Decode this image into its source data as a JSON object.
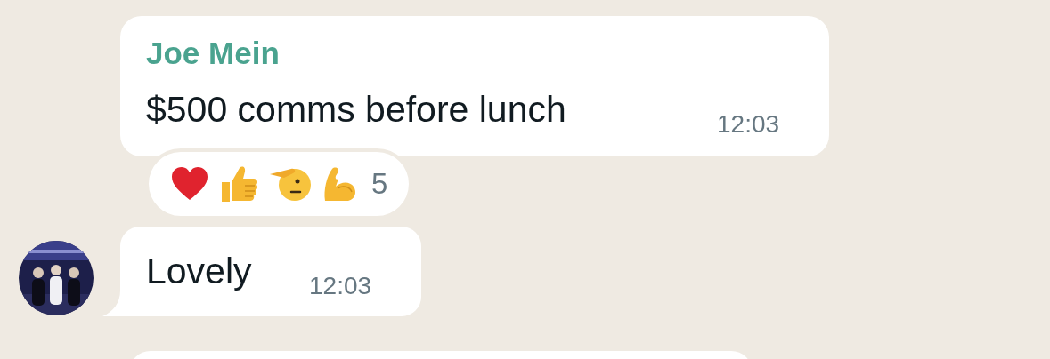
{
  "messages": [
    {
      "kind": "incoming_named",
      "sender": "Joe Mein",
      "text": "$500 comms before lunch",
      "time": "12:03",
      "reactions": [
        {
          "kind": "heart"
        },
        {
          "kind": "thumbs_up"
        },
        {
          "kind": "salute"
        },
        {
          "kind": "muscle"
        }
      ],
      "reaction_count": "5"
    },
    {
      "kind": "incoming_avatar",
      "text": "Lovely",
      "time": "12:03"
    },
    {
      "kind": "cut_off"
    }
  ]
}
